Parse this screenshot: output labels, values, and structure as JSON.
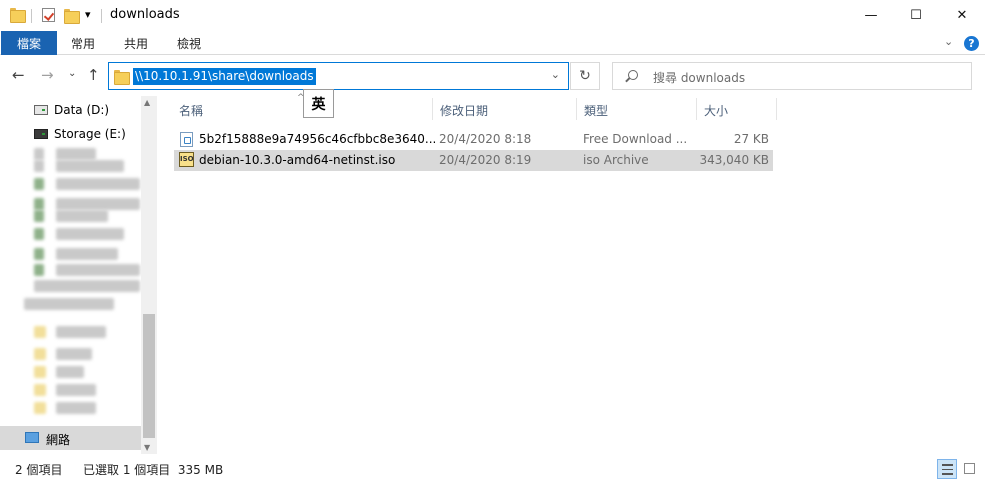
{
  "window": {
    "title": "downloads",
    "minimize_glyph": "—",
    "maximize_glyph": "☐",
    "close_glyph": "✕"
  },
  "quick_access": {
    "dropdown_glyph": "▾"
  },
  "ribbon": {
    "tabs": [
      "檔案",
      "常用",
      "共用",
      "檢視"
    ],
    "collapse_glyph": "⌄",
    "help_glyph": "?"
  },
  "navigation": {
    "back_glyph": "←",
    "forward_glyph": "→",
    "recent_glyph": "⌄",
    "up_glyph": "↑"
  },
  "address_bar": {
    "path": "\\\\10.10.1.91\\share\\downloads",
    "dropdown_glyph": "⌄",
    "refresh_glyph": "↻"
  },
  "search": {
    "placeholder": "搜尋 downloads"
  },
  "ime_indicator": "英",
  "nav_pane": {
    "drives": [
      {
        "label": "Data (D:)",
        "icon": "drive-icon"
      },
      {
        "label": "Storage (E:)",
        "icon": "drive-dark-icon"
      }
    ],
    "network_label": "網路",
    "scroll_up_glyph": "▲",
    "scroll_down_glyph": "▼"
  },
  "columns": {
    "name": "名稱",
    "date_modified": "修改日期",
    "type": "類型",
    "size": "大小",
    "sort_glyph": "^"
  },
  "files": [
    {
      "name": "5b2f15888e9a74956c46cfbbc8e3640...",
      "date": "20/4/2020 8:18",
      "type": "Free Download ...",
      "size": "27 KB",
      "icon": "torrent-file-icon"
    },
    {
      "name": "debian-10.3.0-amd64-netinst.iso",
      "date": "20/4/2020 8:19",
      "type": "iso Archive",
      "size": "343,040 KB",
      "icon": "iso-file-icon",
      "icon_text": "ISO"
    }
  ],
  "status_bar": {
    "item_count": "2 個項目",
    "selection": "已選取 1 個項目  335 MB"
  },
  "colors": {
    "accent": "#0078d7",
    "file_tab": "#1a63b1",
    "selection": "#d9d9d9",
    "nav_selection": "#cce4f7"
  }
}
